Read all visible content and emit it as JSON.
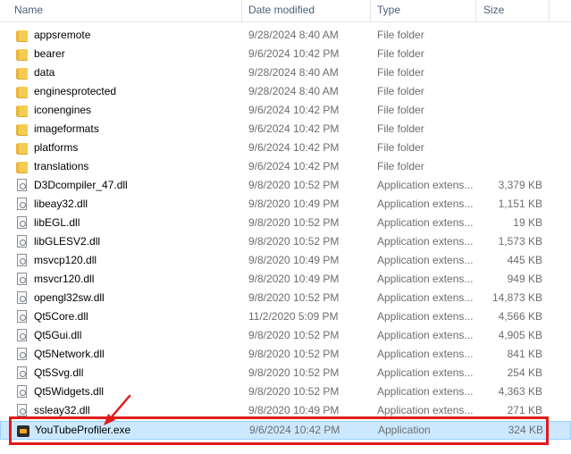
{
  "columns": {
    "name": "Name",
    "date": "Date modified",
    "type": "Type",
    "size": "Size"
  },
  "files": [
    {
      "name": "appsremote",
      "date": "9/28/2024 8:40 AM",
      "type": "File folder",
      "size": "",
      "icon": "folder-icon"
    },
    {
      "name": "bearer",
      "date": "9/6/2024 10:42 PM",
      "type": "File folder",
      "size": "",
      "icon": "folder-icon"
    },
    {
      "name": "data",
      "date": "9/28/2024 8:40 AM",
      "type": "File folder",
      "size": "",
      "icon": "folder-icon"
    },
    {
      "name": "enginesprotected",
      "date": "9/28/2024 8:40 AM",
      "type": "File folder",
      "size": "",
      "icon": "folder-icon"
    },
    {
      "name": "iconengines",
      "date": "9/6/2024 10:42 PM",
      "type": "File folder",
      "size": "",
      "icon": "folder-icon"
    },
    {
      "name": "imageformats",
      "date": "9/6/2024 10:42 PM",
      "type": "File folder",
      "size": "",
      "icon": "folder-icon"
    },
    {
      "name": "platforms",
      "date": "9/6/2024 10:42 PM",
      "type": "File folder",
      "size": "",
      "icon": "folder-icon"
    },
    {
      "name": "translations",
      "date": "9/6/2024 10:42 PM",
      "type": "File folder",
      "size": "",
      "icon": "folder-icon"
    },
    {
      "name": "D3Dcompiler_47.dll",
      "date": "9/8/2020 10:52 PM",
      "type": "Application extens...",
      "size": "3,379 KB",
      "icon": "dll-file-icon"
    },
    {
      "name": "libeay32.dll",
      "date": "9/8/2020 10:49 PM",
      "type": "Application extens...",
      "size": "1,151 KB",
      "icon": "dll-file-icon"
    },
    {
      "name": "libEGL.dll",
      "date": "9/8/2020 10:52 PM",
      "type": "Application extens...",
      "size": "19 KB",
      "icon": "dll-file-icon"
    },
    {
      "name": "libGLESV2.dll",
      "date": "9/8/2020 10:52 PM",
      "type": "Application extens...",
      "size": "1,573 KB",
      "icon": "dll-file-icon"
    },
    {
      "name": "msvcp120.dll",
      "date": "9/8/2020 10:49 PM",
      "type": "Application extens...",
      "size": "445 KB",
      "icon": "dll-file-icon"
    },
    {
      "name": "msvcr120.dll",
      "date": "9/8/2020 10:49 PM",
      "type": "Application extens...",
      "size": "949 KB",
      "icon": "dll-file-icon"
    },
    {
      "name": "opengl32sw.dll",
      "date": "9/8/2020 10:52 PM",
      "type": "Application extens...",
      "size": "14,873 KB",
      "icon": "dll-file-icon"
    },
    {
      "name": "Qt5Core.dll",
      "date": "11/2/2020 5:09 PM",
      "type": "Application extens...",
      "size": "4,566 KB",
      "icon": "dll-file-icon"
    },
    {
      "name": "Qt5Gui.dll",
      "date": "9/8/2020 10:52 PM",
      "type": "Application extens...",
      "size": "4,905 KB",
      "icon": "dll-file-icon"
    },
    {
      "name": "Qt5Network.dll",
      "date": "9/8/2020 10:52 PM",
      "type": "Application extens...",
      "size": "841 KB",
      "icon": "dll-file-icon"
    },
    {
      "name": "Qt5Svg.dll",
      "date": "9/8/2020 10:52 PM",
      "type": "Application extens...",
      "size": "254 KB",
      "icon": "dll-file-icon"
    },
    {
      "name": "Qt5Widgets.dll",
      "date": "9/8/2020 10:52 PM",
      "type": "Application extens...",
      "size": "4,363 KB",
      "icon": "dll-file-icon"
    },
    {
      "name": "ssleay32.dll",
      "date": "9/8/2020 10:49 PM",
      "type": "Application extens...",
      "size": "271 KB",
      "icon": "dll-file-icon"
    },
    {
      "name": "YouTubeProfiler.exe",
      "date": "9/6/2024 10:42 PM",
      "type": "Application",
      "size": "324 KB",
      "icon": "exe-app-icon",
      "selected": true
    }
  ],
  "colors": {
    "selection_bg": "#cce8ff",
    "annotation_red": "#e21b1b",
    "folder": "#f5cc52"
  },
  "annotation": {
    "highlighted_item": "YouTubeProfiler.exe",
    "icon": "red-arrow-icon"
  }
}
